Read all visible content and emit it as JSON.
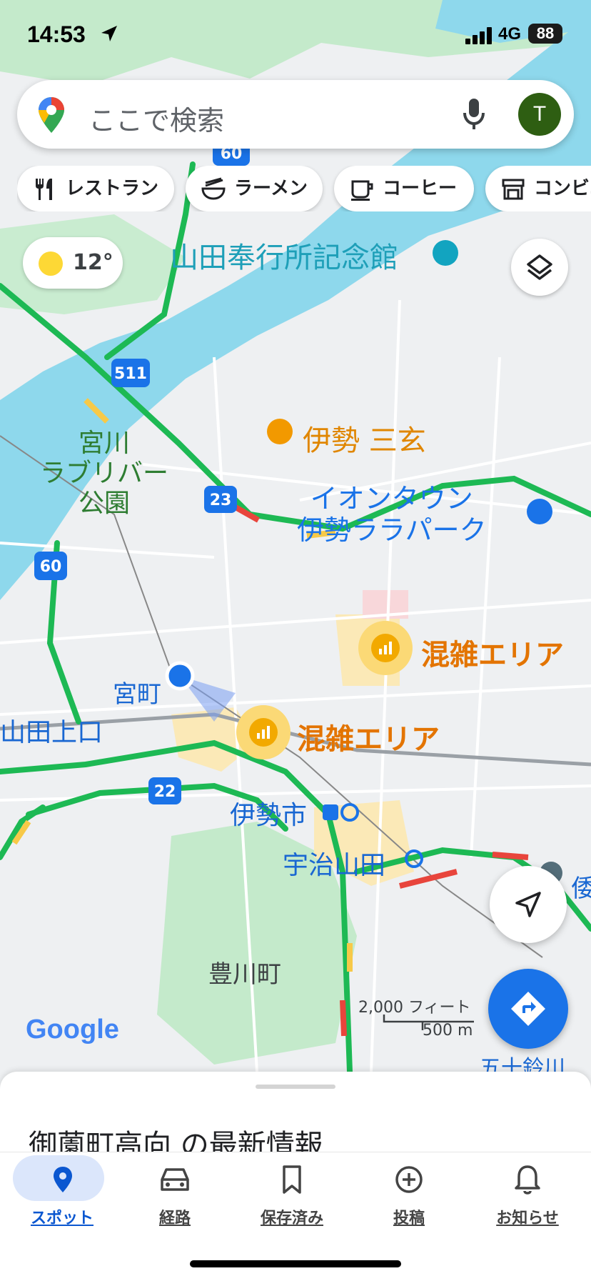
{
  "status": {
    "time": "14:53",
    "network": "4G",
    "battery": "88"
  },
  "search": {
    "placeholder": "ここで検索",
    "avatar_initial": "T"
  },
  "chips": [
    {
      "label": "レストラン",
      "icon": "fork-knife-icon"
    },
    {
      "label": "ラーメン",
      "icon": "ramen-bowl-icon"
    },
    {
      "label": "コーヒー",
      "icon": "coffee-cup-icon"
    },
    {
      "label": "コンビニ",
      "icon": "store-icon"
    }
  ],
  "weather": {
    "temp": "12°"
  },
  "map": {
    "labels": {
      "memorial": "山田奉行所記念館",
      "restaurant": "伊勢 三玄",
      "park": "宮川\nラブリバー\n公園",
      "mall": "イオンタウン\n伊勢ララパーク",
      "miyamachi": "宮町",
      "yamadakamiguchi": "山田上口",
      "iseshi": "伊勢市",
      "ujiyamada": "宇治山田",
      "toyokawa": "豊川町",
      "isuzu": "五十鈴川",
      "edge": "倭"
    },
    "route_shields": [
      "60",
      "511",
      "23",
      "60",
      "22"
    ],
    "crowd_1": "混雑エリア",
    "crowd_2": "混雑エリア"
  },
  "attribution": "Google",
  "scale": {
    "feet": "2,000 フィート",
    "meters": "500 m"
  },
  "sheet": {
    "title": "御薗町高向 の最新情報"
  },
  "nav": [
    {
      "label": "スポット",
      "icon": "pin-icon"
    },
    {
      "label": "経路",
      "icon": "car-icon"
    },
    {
      "label": "保存済み",
      "icon": "bookmark-icon"
    },
    {
      "label": "投稿",
      "icon": "add-circle-icon"
    },
    {
      "label": "お知らせ",
      "icon": "bell-icon"
    }
  ],
  "colors": {
    "water": "#8ed8ec",
    "green": "#bfe8c9",
    "road_green": "#1db954",
    "accent": "#1a73e8",
    "crowd": "#e37400"
  }
}
